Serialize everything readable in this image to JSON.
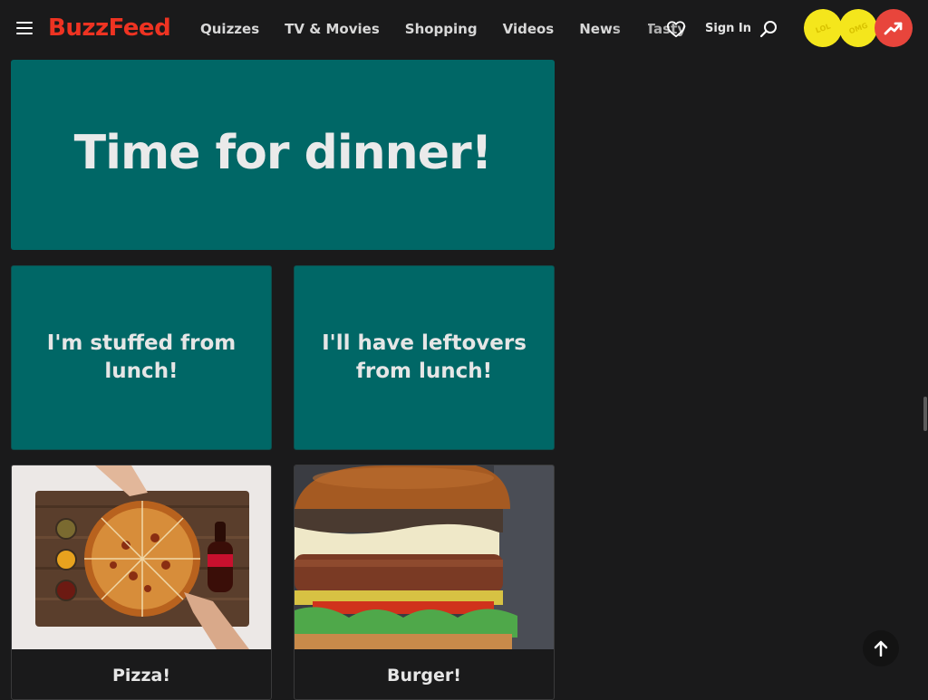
{
  "header": {
    "logo": "BuzzFeed",
    "nav": [
      "Quizzes",
      "TV & Movies",
      "Shopping",
      "Videos",
      "News",
      "Tasty"
    ],
    "signin": "Sign In",
    "badges": [
      {
        "name": "lol-badge",
        "label": "LOL",
        "color": "#f4e61c"
      },
      {
        "name": "omg-badge",
        "label": "OMG",
        "color": "#f4e61c"
      },
      {
        "name": "trending-badge",
        "label": "",
        "color": "#e8453c"
      }
    ],
    "brand_color": "#ee3322",
    "icons": [
      "menu-icon",
      "heart-icon",
      "search-icon",
      "trending-icon",
      "arrow-up-icon"
    ]
  },
  "quiz": {
    "question": "Time for dinner!",
    "card_color": "#006766",
    "answers": [
      {
        "text": "I'm stuffed from lunch!",
        "type": "text"
      },
      {
        "text": "I'll have leftovers from lunch!",
        "type": "text"
      },
      {
        "text": "Pizza!",
        "type": "image",
        "image": "pizza-photo"
      },
      {
        "text": "Burger!",
        "type": "image",
        "image": "burger-photo"
      }
    ]
  }
}
